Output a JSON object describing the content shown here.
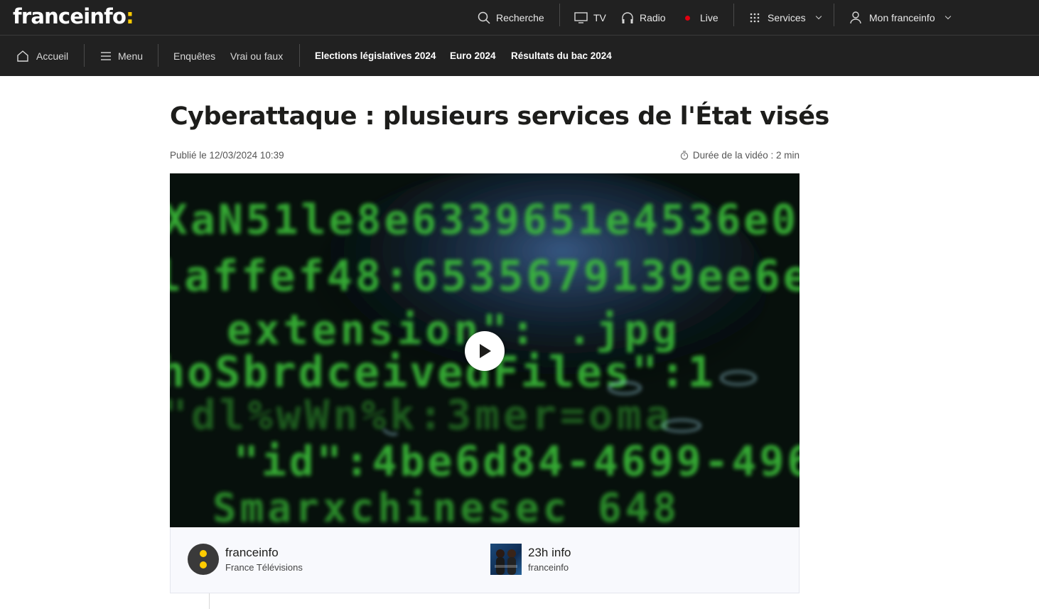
{
  "header": {
    "logo_text": "franceinfo",
    "logo_colon": ":",
    "search_label": "Recherche",
    "tv_label": "TV",
    "radio_label": "Radio",
    "live_label": "Live",
    "services_label": "Services",
    "account_label": "Mon franceinfo"
  },
  "nav": {
    "home_label": "Accueil",
    "menu_label": "Menu",
    "items": [
      "Enquêtes",
      "Vrai ou faux"
    ],
    "highlights": [
      "Elections législatives 2024",
      "Euro 2024",
      "Résultats du bac 2024"
    ]
  },
  "article": {
    "title": "Cyberattaque : plusieurs services de l'État visés",
    "published": "Publié le 12/03/2024 10:39",
    "duration": "Durée de la vidéo : 2 min"
  },
  "sources": [
    {
      "name": "franceinfo",
      "sub": "France Télévisions"
    },
    {
      "name": "23h info",
      "sub": "franceinfo"
    }
  ],
  "colors": {
    "header_bg": "#212121",
    "brand_yellow": "#fecb00",
    "live_red": "#e1000f"
  },
  "icons": [
    "search-icon",
    "tv-icon",
    "headphones-icon",
    "live-dot-icon",
    "grid-icon",
    "user-icon",
    "chevron-down-icon",
    "home-icon",
    "hamburger-icon",
    "timer-icon",
    "play-icon"
  ]
}
